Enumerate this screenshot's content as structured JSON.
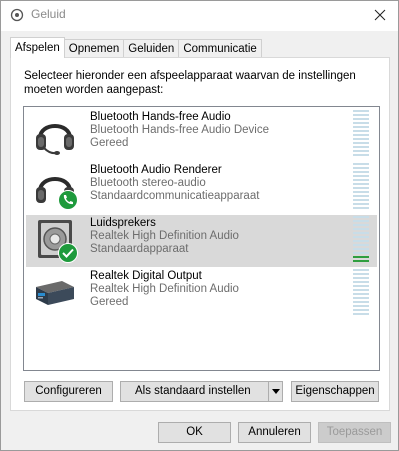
{
  "window": {
    "title": "Geluid"
  },
  "tabs": [
    {
      "label": "Afspelen"
    },
    {
      "label": "Opnemen"
    },
    {
      "label": "Geluiden"
    },
    {
      "label": "Communicatie"
    }
  ],
  "instruction": "Selecteer hieronder een afspeelapparaat waarvan de instellingen moeten worden aangepast:",
  "devices": [
    {
      "name": "Bluetooth Hands-free Audio",
      "description": "Bluetooth Hands-free Audio Device",
      "status": "Gereed",
      "icon": "headset-icon",
      "badge": "",
      "selected": false
    },
    {
      "name": "Bluetooth Audio Renderer",
      "description": "Bluetooth stereo-audio",
      "status": "Standaardcommunicatieapparaat",
      "icon": "headset-icon",
      "badge": "phone-badge-icon",
      "selected": false
    },
    {
      "name": "Luidsprekers",
      "description": "Realtek High Definition Audio",
      "status": "Standaardapparaat",
      "icon": "speaker-icon",
      "badge": "check-badge-icon",
      "selected": true,
      "level": 0.1
    },
    {
      "name": "Realtek Digital Output",
      "description": "Realtek High Definition Audio",
      "status": "Gereed",
      "icon": "digital-output-icon",
      "badge": "",
      "selected": false
    }
  ],
  "buttons": {
    "configure": "Configureren",
    "set_default": "Als standaard instellen",
    "properties": "Eigenschappen",
    "ok": "OK",
    "cancel": "Annuleren",
    "apply": "Toepassen"
  },
  "colors": {
    "selection": "#d9d9d9",
    "meter_idle": "#c8dde8",
    "meter_active": "#2f9e3f",
    "badge_green": "#1e9a3c"
  }
}
